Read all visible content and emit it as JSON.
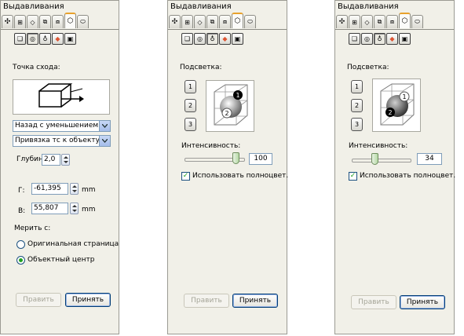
{
  "panels": [
    {
      "title": "Выдавливания",
      "vanishing_label": "Точка схода:",
      "vp_type": "Назад с уменьшением",
      "vp_lock": "Привязка тс к объекту",
      "depth_label": "Глубин",
      "depth_value": "2,0",
      "h_label": "Г:",
      "h_value": "-61,395",
      "v_label": "В:",
      "v_value": "55,807",
      "unit": "mm",
      "measure_label": "Мерить с:",
      "radio_page": "Оригинальная страница",
      "radio_center": "Объектный центр",
      "edit_label": "Править",
      "apply_label": "Принять"
    },
    {
      "title": "Выдавливания",
      "lighting_label": "Подсветка:",
      "light_numbers": [
        "1",
        "2",
        "3"
      ],
      "intensity_label": "Интенсивность:",
      "intensity_value": "100",
      "intensity_level": 1.0,
      "full_color_label": "Использовать полноцвет.",
      "edit_label": "Править",
      "apply_label": "Принять"
    },
    {
      "title": "Выдавливания",
      "lighting_label": "Подсветка:",
      "light_numbers": [
        "1",
        "2",
        "3"
      ],
      "intensity_label": "Интенсивность:",
      "intensity_value": "34",
      "intensity_level": 0.34,
      "full_color_label": "Использовать полноцвет.",
      "edit_label": "Править",
      "apply_label": "Принять"
    }
  ],
  "icons": [
    "extrude-preset-icon",
    "vanishing-point-icon",
    "rotation-icon",
    "color-icon",
    "bevel-icon",
    "lighting-icon",
    "docker-tab-icon"
  ],
  "colors": {
    "panel_bg": "#f1f0e8",
    "active_tab_accent": "#e8a12c",
    "check_green": "#21a121"
  }
}
